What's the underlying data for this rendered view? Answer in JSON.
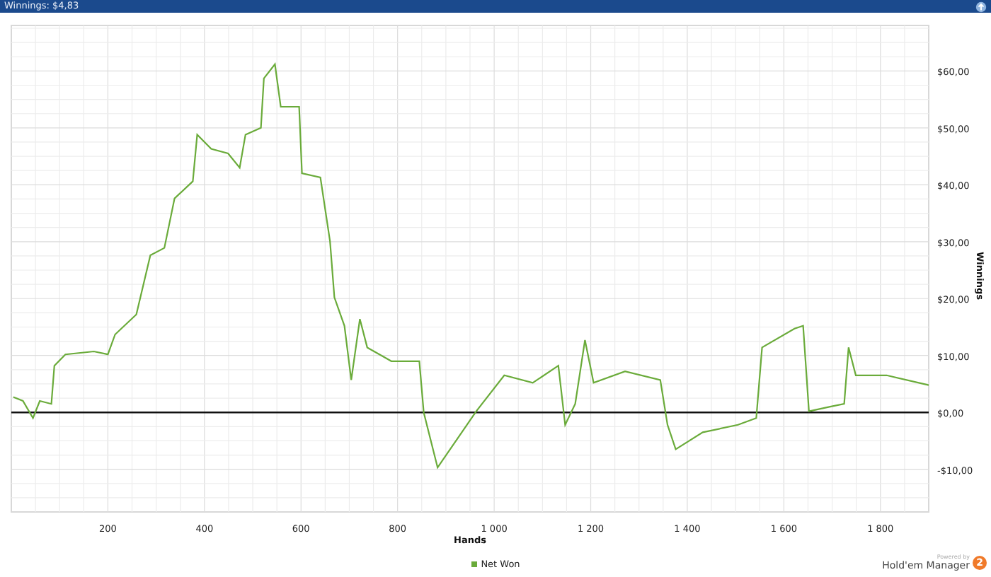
{
  "window": {
    "title": "Winnings: $4,83"
  },
  "chart": {
    "chart_data": {
      "type": "line",
      "grid": true,
      "xlabel": "Hands",
      "ylabel": "Winnings",
      "xlim": [
        0,
        1900
      ],
      "ylim": [
        -17.5,
        68
      ],
      "xticks": [
        200,
        400,
        600,
        800,
        {
          "value": 1000,
          "label": "1 000"
        },
        {
          "value": 1200,
          "label": "1 200"
        },
        {
          "value": 1400,
          "label": "1 400"
        },
        {
          "value": 1600,
          "label": "1 600"
        },
        {
          "value": 1800,
          "label": "1 800"
        }
      ],
      "yticks": [
        {
          "value": -10,
          "label": "-$10,00"
        },
        {
          "value": 0,
          "label": "$0,00"
        },
        {
          "value": 10,
          "label": "$10,00"
        },
        {
          "value": 20,
          "label": "$20,00"
        },
        {
          "value": 30,
          "label": "$30,00"
        },
        {
          "value": 40,
          "label": "$40,00"
        },
        {
          "value": 50,
          "label": "$50,00"
        },
        {
          "value": 60,
          "label": "$60,00"
        }
      ],
      "x": [
        4,
        24,
        45,
        59,
        83,
        89,
        112,
        171,
        200,
        215,
        259,
        288,
        317,
        338,
        376,
        385,
        414,
        449,
        473,
        485,
        517,
        523,
        546,
        558,
        596,
        602,
        640,
        660,
        669,
        690,
        704,
        722,
        737,
        787,
        845,
        854,
        883,
        933,
        963,
        1021,
        1080,
        1133,
        1147,
        1168,
        1188,
        1206,
        1271,
        1344,
        1359,
        1376,
        1432,
        1505,
        1543,
        1555,
        1622,
        1640,
        1652,
        1696,
        1725,
        1734,
        1749,
        1813,
        1900
      ],
      "series": [
        {
          "name": "Net Won",
          "color": "#6aab3a",
          "values": [
            2.7,
            2.0,
            -1.0,
            2.0,
            1.5,
            8.2,
            10.2,
            10.7,
            10.2,
            13.7,
            17.2,
            27.6,
            28.9,
            37.6,
            40.6,
            48.8,
            46.3,
            45.5,
            43.0,
            48.8,
            50.0,
            58.7,
            61.2,
            53.7,
            53.7,
            42.0,
            41.3,
            30.1,
            20.2,
            15.2,
            5.7,
            16.4,
            11.4,
            9.0,
            9.0,
            0,
            -9.7,
            -3.5,
            0.2,
            6.5,
            5.2,
            8.2,
            -2.2,
            1.5,
            12.7,
            5.2,
            7.2,
            5.7,
            -2.2,
            -6.5,
            -3.5,
            -2.2,
            -1.0,
            11.4,
            14.7,
            15.2,
            0.2,
            1.0,
            1.5,
            11.4,
            6.5,
            6.5,
            4.8
          ]
        }
      ]
    }
  },
  "branding": {
    "caption": "Powered by",
    "name": "Hold'em Manager",
    "badge": "2"
  }
}
